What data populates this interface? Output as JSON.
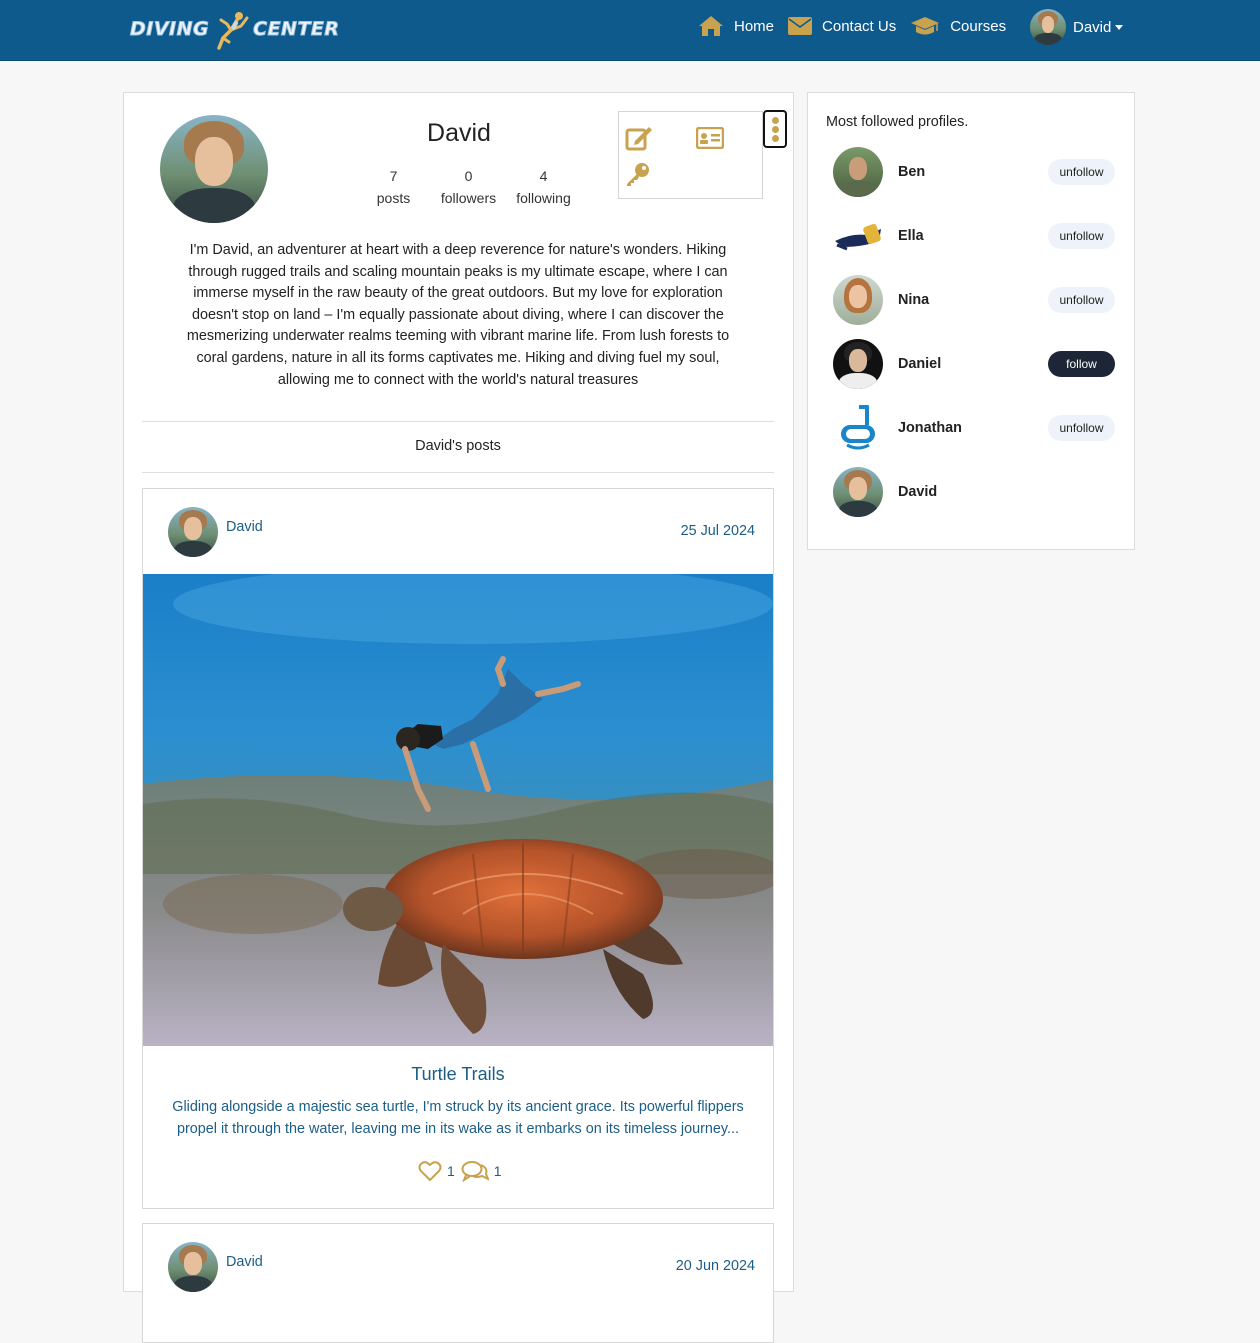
{
  "nav": {
    "logo_left": "DIVING",
    "logo_right": "CENTER",
    "links": [
      {
        "label": "Home",
        "icon": "home-icon"
      },
      {
        "label": "Contact Us",
        "icon": "envelope-icon"
      },
      {
        "label": "Courses",
        "icon": "graduation-cap-icon"
      }
    ],
    "user": "David",
    "colors": {
      "navbar": "#0f5a8c",
      "accent": "#c9a24f"
    }
  },
  "profile": {
    "name": "David",
    "stats": [
      {
        "value": "7",
        "label": "posts"
      },
      {
        "value": "0",
        "label": "followers"
      },
      {
        "value": "4",
        "label": "following"
      }
    ],
    "actions": [
      "edit-icon",
      "id-card-icon",
      "key-icon"
    ],
    "bio": "I'm David, an adventurer at heart with a deep reverence for nature's wonders. Hiking through rugged trails and scaling mountain peaks is my ultimate escape, where I can immerse myself in the raw beauty of the great outdoors. But my love for exploration doesn't stop on land – I'm equally passionate about diving, where I can discover the mesmerizing underwater realms teeming with vibrant marine life. From lush forests to coral gardens, nature in all its forms captivates me. Hiking and diving fuel my soul, allowing me to connect with the world's natural treasures",
    "posts_heading": "David's posts"
  },
  "posts": [
    {
      "author": "David",
      "date": "25 Jul 2024",
      "title": "Turtle Trails",
      "text": "Gliding alongside a majestic sea turtle, I'm struck by its ancient grace. Its powerful flippers propel it through the water, leaving me in its wake as it embarks on its timeless journey...",
      "likes": "1",
      "comments": "1"
    },
    {
      "author": "David",
      "date": "20 Jun 2024"
    }
  ],
  "sidebar": {
    "title": "Most followed profiles.",
    "profiles": [
      {
        "name": "Ben",
        "button": "unfollow"
      },
      {
        "name": "Ella",
        "button": "unfollow"
      },
      {
        "name": "Nina",
        "button": "unfollow"
      },
      {
        "name": "Daniel",
        "button": "follow"
      },
      {
        "name": "Jonathan",
        "button": "unfollow"
      },
      {
        "name": "David",
        "button": ""
      }
    ]
  }
}
